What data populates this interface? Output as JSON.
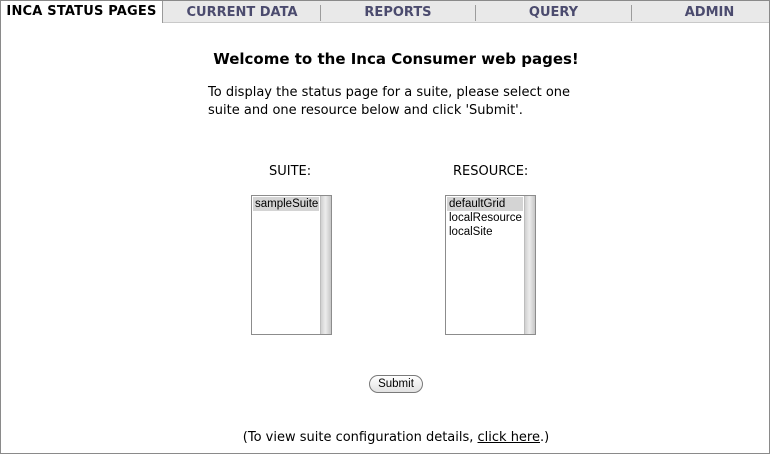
{
  "nav": {
    "brand": "INCA STATUS PAGES",
    "tabs": [
      {
        "label": "CURRENT DATA"
      },
      {
        "label": "REPORTS"
      },
      {
        "label": "QUERY"
      },
      {
        "label": "ADMIN"
      }
    ]
  },
  "main": {
    "title": "Welcome to the Inca Consumer web pages!",
    "intro_line1": "To display the status page for a suite, please select one",
    "intro_line2": "suite and one resource below and click 'Submit'.",
    "suite": {
      "label": "SUITE:",
      "options": [
        "sampleSuite"
      ],
      "selected": "sampleSuite"
    },
    "resource": {
      "label": "RESOURCE:",
      "options": [
        "defaultGrid",
        "localResource",
        "localSite"
      ],
      "selected": "defaultGrid"
    },
    "submit_label": "Submit",
    "footer_prefix": "(To view suite configuration details, ",
    "footer_link": "click here",
    "footer_suffix": ".)"
  },
  "colors": {
    "nav_bg": "#e9e9e9",
    "nav_text": "#4b4b6e",
    "selected_option_bg": "#d4d4d4"
  }
}
